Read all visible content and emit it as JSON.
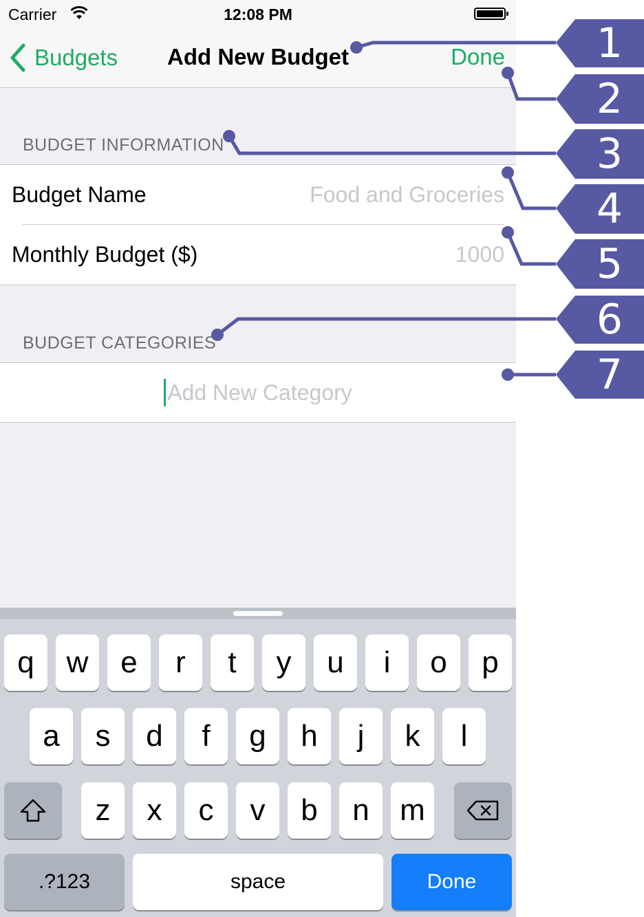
{
  "status_bar": {
    "carrier": "Carrier",
    "time": "12:08 PM"
  },
  "nav": {
    "back_label": "Budgets",
    "title": "Add New Budget",
    "done_label": "Done"
  },
  "budget_information": {
    "header": "BUDGET INFORMATION",
    "rows": [
      {
        "label": "Budget Name",
        "placeholder": "Food and Groceries"
      },
      {
        "label": "Monthly Budget ($)",
        "placeholder": "1000"
      }
    ]
  },
  "budget_categories": {
    "header": "BUDGET CATEGORIES",
    "add_placeholder": "Add New Category"
  },
  "keyboard": {
    "row1": [
      "q",
      "w",
      "e",
      "r",
      "t",
      "y",
      "u",
      "i",
      "o",
      "p"
    ],
    "row2": [
      "a",
      "s",
      "d",
      "f",
      "g",
      "h",
      "j",
      "k",
      "l"
    ],
    "row3": [
      "z",
      "x",
      "c",
      "v",
      "b",
      "n",
      "m"
    ],
    "numbers_label": ".?123",
    "space_label": "space",
    "done_label": "Done"
  },
  "callouts": [
    "1",
    "2",
    "3",
    "4",
    "5",
    "6",
    "7"
  ],
  "colors": {
    "accent": "#1dac65",
    "callout": "#5759a3",
    "keyboard_done": "#147efb"
  }
}
